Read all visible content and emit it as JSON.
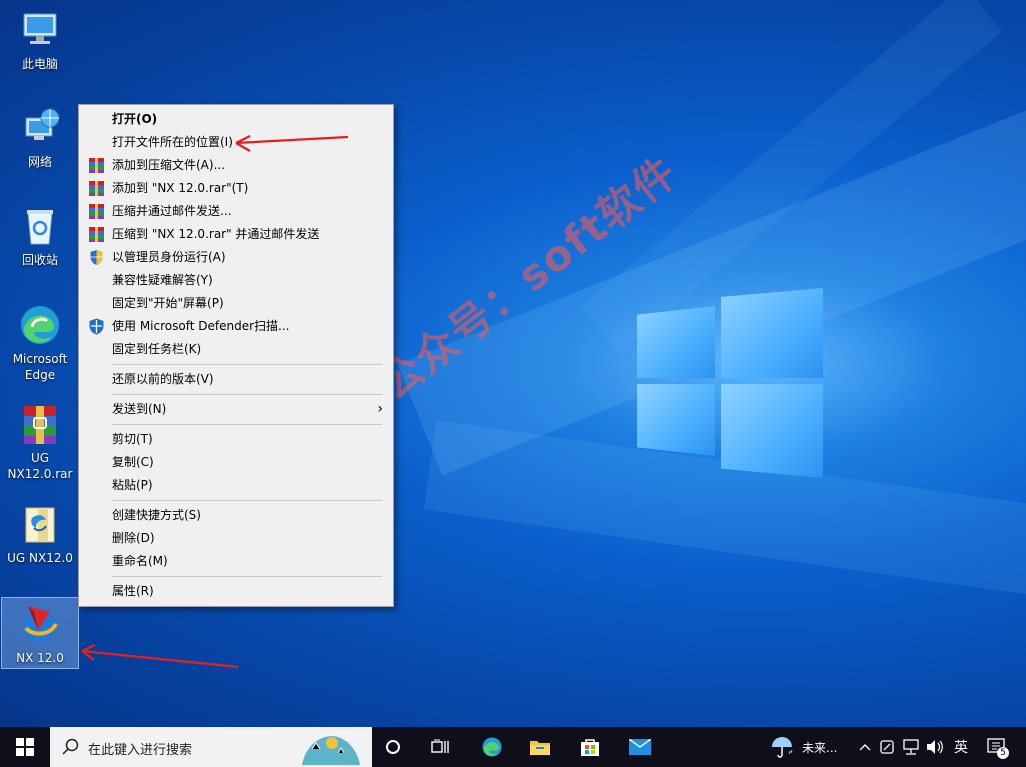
{
  "desktop": {
    "icons": [
      {
        "label": "此电脑"
      },
      {
        "label": "网络"
      },
      {
        "label": "回收站"
      },
      {
        "label": "Microsoft Edge"
      },
      {
        "label": "UG NX12.0.rar"
      },
      {
        "label": "UG NX12.0"
      },
      {
        "label": "NX 12.0"
      }
    ],
    "watermark": "微信公众号：soft软件"
  },
  "context_menu": {
    "items": [
      {
        "label": "打开(O)"
      },
      {
        "label": "打开文件所在的位置(I)"
      },
      {
        "label": "添加到压缩文件(A)..."
      },
      {
        "label": "添加到 \"NX 12.0.rar\"(T)"
      },
      {
        "label": "压缩并通过邮件发送..."
      },
      {
        "label": "压缩到 \"NX 12.0.rar\" 并通过邮件发送"
      },
      {
        "label": "以管理员身份运行(A)"
      },
      {
        "label": "兼容性疑难解答(Y)"
      },
      {
        "label": "固定到\"开始\"屏幕(P)"
      },
      {
        "label": "使用 Microsoft Defender扫描..."
      },
      {
        "label": "固定到任务栏(K)"
      },
      {
        "label": "还原以前的版本(V)"
      },
      {
        "label": "发送到(N)"
      },
      {
        "label": "剪切(T)"
      },
      {
        "label": "复制(C)"
      },
      {
        "label": "粘贴(P)"
      },
      {
        "label": "创建快捷方式(S)"
      },
      {
        "label": "删除(D)"
      },
      {
        "label": "重命名(M)"
      },
      {
        "label": "属性(R)"
      }
    ]
  },
  "taskbar": {
    "search_placeholder": "在此键入进行搜索",
    "weather": "未来...",
    "ime": "英",
    "notification_count": "5"
  },
  "colors": {
    "accent": "#0a5fcc",
    "annotation": "#e2201c",
    "taskbar": "#0f0f1c"
  }
}
